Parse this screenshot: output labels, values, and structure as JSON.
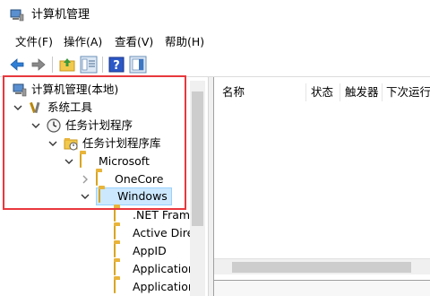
{
  "window": {
    "title": "计算机管理"
  },
  "menu": {
    "items": [
      "文件(F)",
      "操作(A)",
      "查看(V)",
      "帮助(H)"
    ]
  },
  "toolbar": {
    "buttons": [
      "back-arrow-icon",
      "forward-arrow-icon",
      "up-folder-icon",
      "show-hide-tree-icon",
      "help-icon",
      "show-action-pane-icon"
    ]
  },
  "tree": {
    "items": [
      {
        "label": "计算机管理(本地)",
        "icon": "computer-management-icon"
      },
      {
        "label": "系统工具",
        "icon": "tools-icon"
      },
      {
        "label": "任务计划程序",
        "icon": "clock-icon"
      },
      {
        "label": "任务计划程序库",
        "icon": "folder-clock-icon"
      },
      {
        "label": "Microsoft",
        "icon": "folder-icon"
      },
      {
        "label": "OneCore",
        "icon": "folder-icon"
      },
      {
        "label": "Windows",
        "icon": "folder-icon"
      },
      {
        "label": ".NET Frame",
        "icon": "folder-icon"
      },
      {
        "label": "Active Direc",
        "icon": "folder-icon"
      },
      {
        "label": "AppID",
        "icon": "folder-icon"
      },
      {
        "label": "Application",
        "icon": "folder-icon"
      },
      {
        "label": "Application",
        "icon": "folder-icon"
      }
    ],
    "selected": "Windows"
  },
  "results": {
    "columns": [
      "名称",
      "状态",
      "触发器",
      "下次运行时"
    ]
  },
  "colors": {
    "highlight_box": "#e8383d",
    "selection": "#cce8ff",
    "folder": "#f2c94c"
  }
}
